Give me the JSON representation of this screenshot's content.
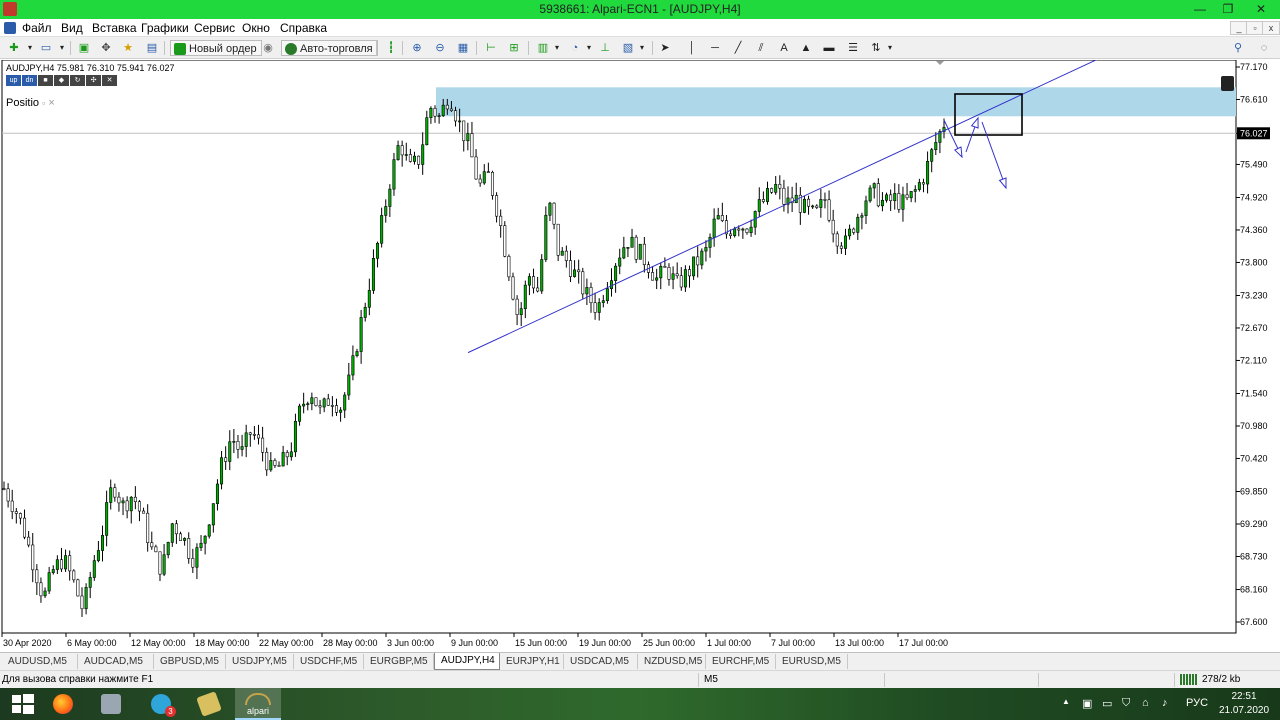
{
  "window": {
    "title": "5938661: Alpari-ECN1 - [AUDJPY,H4]",
    "minimize": "—",
    "maximize": "❐",
    "close": "✕"
  },
  "menu": {
    "items": [
      "Файл",
      "Вид",
      "Вставка",
      "Графики",
      "Сервис",
      "Окно",
      "Справка"
    ],
    "mdi": [
      "_",
      "▫",
      "x"
    ]
  },
  "toolbar": {
    "new_order": "Новый ордер",
    "auto_trading": "Авто-торговля"
  },
  "chart": {
    "symbol_info": "AUDJPY,H4  75.981 76.310 75.941 76.027",
    "mini_icons": [
      "up",
      "dn",
      "",
      "",
      "",
      ""
    ],
    "panel_label": "Positio",
    "panel_restore": "▫",
    "panel_close": "×",
    "current_price": "76.027",
    "accent_candle": "#00aa00",
    "trend_color": "#3333cc",
    "zone_color": "#aed8ea"
  },
  "chart_data": {
    "type": "candlestick",
    "symbol": "AUDJPY",
    "timeframe": "H4",
    "ylim": [
      67.6,
      77.17
    ],
    "y_ticks": [
      "77.170",
      "76.610",
      "76.027",
      "75.490",
      "74.920",
      "74.360",
      "73.800",
      "73.230",
      "72.670",
      "72.110",
      "71.540",
      "70.980",
      "70.420",
      "69.850",
      "69.290",
      "68.730",
      "68.160",
      "67.600"
    ],
    "x_ticks": [
      "30 Apr 2020",
      "6 May 00:00",
      "12 May 00:00",
      "18 May 00:00",
      "22 May 00:00",
      "28 May 00:00",
      "3 Jun 00:00",
      "9 Jun 00:00",
      "15 Jun 00:00",
      "19 Jun 00:00",
      "25 Jun 00:00",
      "1 Jul 00:00",
      "7 Jul 00:00",
      "13 Jul 00:00",
      "17 Jul 00:00"
    ],
    "ohlc_path": [
      69.9,
      69.6,
      69.2,
      68.6,
      68.0,
      68.5,
      68.7,
      68.3,
      67.8,
      68.6,
      69.2,
      70.0,
      69.6,
      69.8,
      69.4,
      68.8,
      68.5,
      69.3,
      69.1,
      68.7,
      68.9,
      69.6,
      70.3,
      70.8,
      70.5,
      70.9,
      70.6,
      70.2,
      70.3,
      70.6,
      71.3,
      71.6,
      71.2,
      71.5,
      71.3,
      71.8,
      72.7,
      73.5,
      74.3,
      75.2,
      75.9,
      75.4,
      75.6,
      76.5,
      76.3,
      76.7,
      76.2,
      75.8,
      75.1,
      75.3,
      74.6,
      73.7,
      72.8,
      73.6,
      73.3,
      74.9,
      74.0,
      73.8,
      73.5,
      73.2,
      73.0,
      73.5,
      73.9,
      74.2,
      74.0,
      73.8,
      73.5,
      73.7,
      73.4,
      73.6,
      73.8,
      74.0,
      74.6,
      74.3,
      74.5,
      74.4,
      74.7,
      74.9,
      75.1,
      74.8,
      74.9,
      74.7,
      74.6,
      74.9,
      74.3,
      74.1,
      74.5,
      74.9,
      75.0,
      74.8,
      74.9,
      74.8,
      75.0,
      75.3,
      75.8,
      76.2
    ],
    "resistance_zone": [
      76.32,
      76.82
    ],
    "trendline": [
      {
        "x": "9 Jun 00:00",
        "y": 72.1
      },
      {
        "x": "17 Jul 00:00",
        "y": 75.7
      }
    ],
    "annotations": [
      "box",
      "down-arrow",
      "up-arrow",
      "down-arrow"
    ]
  },
  "tabs": {
    "items": [
      "AUDUSD,M5",
      "AUDCAD,M5",
      "GBPUSD,M5",
      "USDJPY,M5",
      "USDCHF,M5",
      "EURGBP,M5",
      "AUDJPY,H4",
      "EURJPY,H1",
      "USDCAD,M5",
      "NZDUSD,M5",
      "EURCHF,M5",
      "EURUSD,M5"
    ],
    "active_index": 6
  },
  "status": {
    "help": "Для вызова справки нажмите F1",
    "profile": "M5",
    "traffic": "278/2 kb"
  },
  "taskbar": {
    "telegram_badge": "3",
    "alpari_label": "alpari",
    "lang": "РУС",
    "time": "22:51",
    "date": "21.07.2020"
  }
}
